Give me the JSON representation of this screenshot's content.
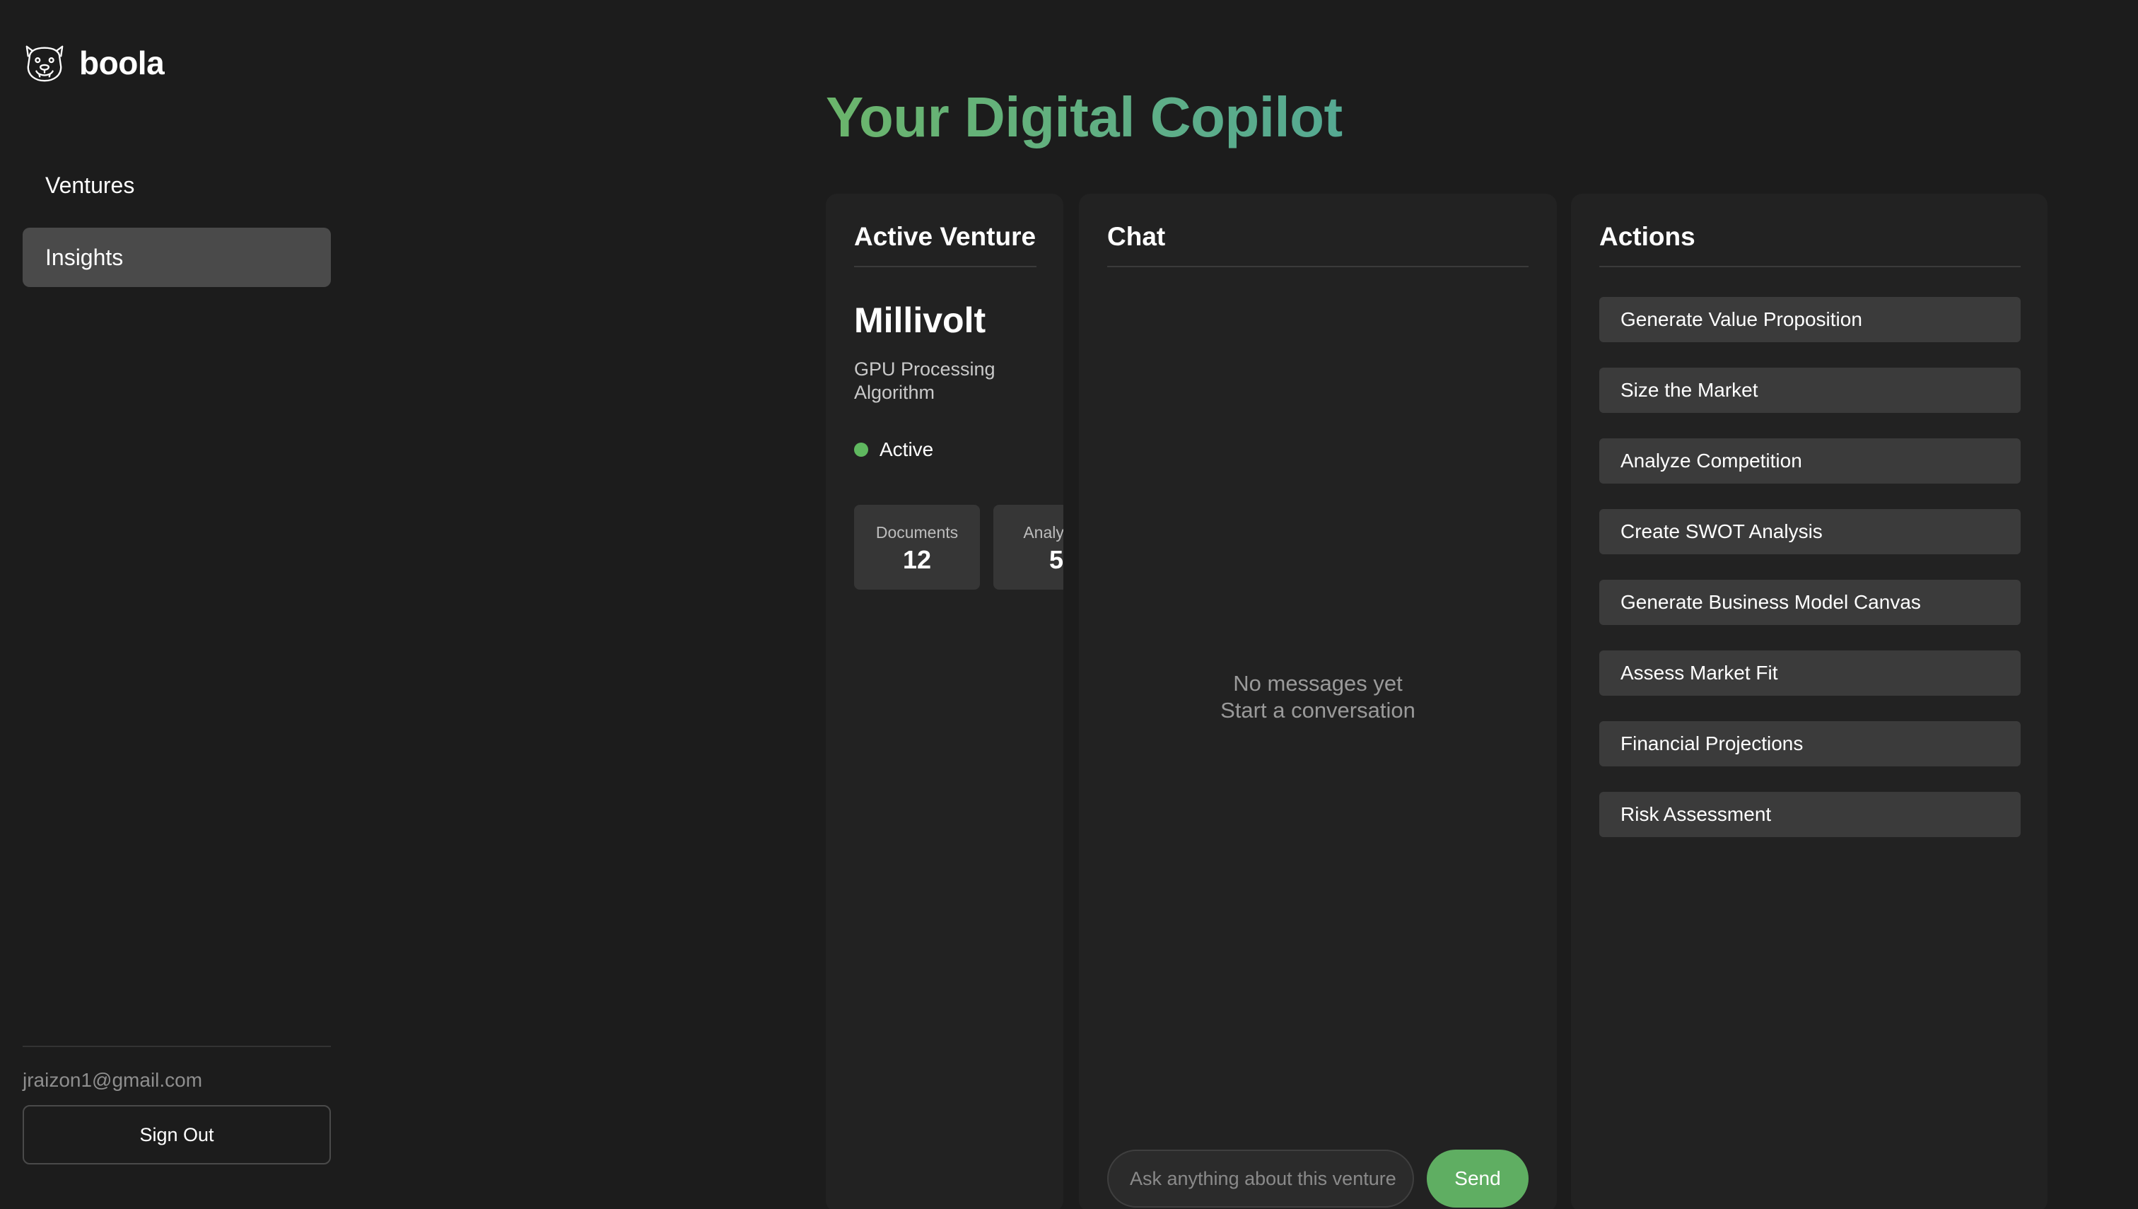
{
  "brand": {
    "name": "boola",
    "icon": "bulldog-icon"
  },
  "nav": {
    "items": [
      {
        "label": "Ventures",
        "active": false
      },
      {
        "label": "Insights",
        "active": true
      }
    ]
  },
  "user": {
    "email": "jraizon1@gmail.com",
    "sign_out_label": "Sign Out"
  },
  "main": {
    "title": "Your Digital Copilot"
  },
  "venture_panel": {
    "header": "Active Venture",
    "name": "Millivolt",
    "description": "GPU Processing Algorithm",
    "status": "Active",
    "status_color": "#5fb85f",
    "stats": [
      {
        "label": "Documents",
        "value": "12"
      },
      {
        "label": "Analyses",
        "value": "5"
      }
    ]
  },
  "chat_panel": {
    "header": "Chat",
    "empty_line1": "No messages yet",
    "empty_line2": "Start a conversation",
    "input_placeholder": "Ask anything about this venture",
    "send_label": "Send",
    "send_color": "#5fae62"
  },
  "actions_panel": {
    "header": "Actions",
    "items": [
      "Generate Value Proposition",
      "Size the Market",
      "Analyze Competition",
      "Create SWOT Analysis",
      "Generate Business Model Canvas",
      "Assess Market Fit",
      "Financial Projections",
      "Risk Assessment"
    ]
  },
  "colors": {
    "background": "#1c1c1c",
    "panel": "#222222",
    "title_gradient_start": "#6bb56b",
    "title_gradient_end": "#55a992",
    "accent": "#5fae62"
  }
}
